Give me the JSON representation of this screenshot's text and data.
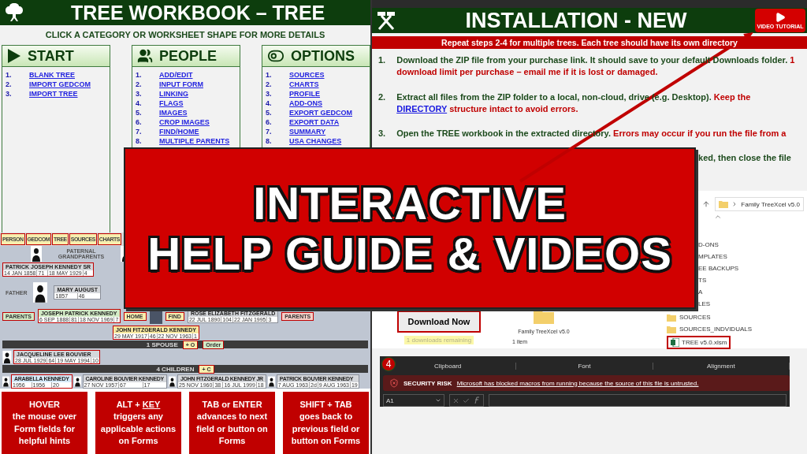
{
  "tree_workbook": {
    "title": "TREE WORKBOOK – TREE",
    "subtitle": "CLICK A CATEGORY OR WORKSHEET SHAPE FOR MORE DETAILS",
    "categories": [
      {
        "kind": "start",
        "title": "START",
        "items": [
          {
            "number": "1.",
            "label": "BLANK TREE"
          },
          {
            "number": "2.",
            "label": "IMPORT GEDCOM"
          },
          {
            "number": "3.",
            "label": "IMPORT TREE"
          }
        ]
      },
      {
        "kind": "people",
        "title": "PEOPLE",
        "items": [
          {
            "number": "1.",
            "label": "ADD/EDIT"
          },
          {
            "number": "2.",
            "label": "INPUT FORM"
          },
          {
            "number": "3.",
            "label": "LINKING"
          },
          {
            "number": "4.",
            "label": "FLAGS"
          },
          {
            "number": "5.",
            "label": "IMAGES"
          },
          {
            "number": "6.",
            "label": "CROP IMAGES"
          },
          {
            "number": "7.",
            "label": "FIND/HOME"
          },
          {
            "number": "8.",
            "label": "MULTIPLE PARENTS"
          }
        ]
      },
      {
        "kind": "options",
        "title": "OPTIONS",
        "items": [
          {
            "number": "1.",
            "label": "SOURCES"
          },
          {
            "number": "2.",
            "label": "CHARTS"
          },
          {
            "number": "3.",
            "label": "PROFILE"
          },
          {
            "number": "4.",
            "label": "ADD-ONS"
          },
          {
            "number": "5.",
            "label": "EXPORT GEDCOM"
          },
          {
            "number": "6.",
            "label": "EXPORT DATA"
          },
          {
            "number": "7.",
            "label": "SUMMARY"
          },
          {
            "number": "8.",
            "label": "USA CHANGES"
          }
        ]
      }
    ],
    "toolbar": [
      "PERSON",
      "GEDCOM",
      "TREE",
      "SOURCES",
      "CHARTS"
    ],
    "family_tree": {
      "grandparents_label": "PATERNAL GRANDPARENTS",
      "father_label": "FATHER",
      "parents_buttons": [
        "PARENTS",
        "PARENTS"
      ],
      "home_button": "HOME",
      "find_button": "FIND",
      "spouse_bar": "1 SPOUSE",
      "spouse_add": "+ O",
      "order_button": "Order",
      "children_bar": "4 CHILDREN",
      "child_add": "+ C",
      "grandparents": [
        {
          "name": "PATRICK JOSEPH KENNEDY SR",
          "kind": "plain",
          "highlighted": true,
          "dates": [
            "14 JAN 1858",
            "71",
            "18 MAY 1929",
            "4"
          ]
        },
        {
          "name": "MARY AUGUST",
          "kind": "plain",
          "highlighted": false,
          "dates": [
            "1857",
            "46"
          ]
        }
      ],
      "father": {
        "name": "JOSEPH PATRICK KENNEDY",
        "kind": "parent",
        "highlighted": true,
        "dates": [
          "6 SEP 1888",
          "81",
          "18 NOV 1969",
          "7"
        ]
      },
      "mother": {
        "name": "ROSE ELIZABETH FITZGERALD",
        "kind": "plain",
        "highlighted": false,
        "dates": [
          "22 JUL 1890",
          "104",
          "22 JAN 1995",
          "3"
        ]
      },
      "person": {
        "name": "JOHN FITZGERALD KENNEDY",
        "kind": "main",
        "highlighted": true,
        "dates": [
          "29 MAY 1917",
          "46",
          "22 NOV 1963",
          "1"
        ]
      },
      "spouse": {
        "name": "JACQUELINE LEE BOUVIER",
        "kind": "plain",
        "highlighted": true,
        "dates": [
          "28 JUL 1929",
          "64",
          "19 MAY 1994",
          "10"
        ]
      },
      "children": [
        {
          "name": "ARABELLA KENNEDY",
          "kind": "child",
          "highlighted": true,
          "dates": [
            "1956",
            "1956",
            "20"
          ]
        },
        {
          "name": "CAROLINE BOUVIER KENNEDY",
          "kind": "plain",
          "highlighted": false,
          "dates": [
            "27 NOV 1957",
            "67",
            "17"
          ]
        },
        {
          "name": "JOHN FITZGERALD KENNEDY JR",
          "kind": "plain",
          "highlighted": false,
          "dates": [
            "25 NOV 1960",
            "38",
            "16 JUL 1999",
            "18"
          ]
        },
        {
          "name": "PATRICK BOUVIER KENNEDY",
          "kind": "plain",
          "highlighted": false,
          "dates": [
            "7 AUG 1963",
            "2d",
            "9 AUG 1963",
            "19"
          ]
        }
      ]
    },
    "hints": [
      {
        "title": "HOVER",
        "text": "the mouse over Form fields for helpful hints"
      },
      {
        "title": "ALT +",
        "key": "KEY",
        "text": "triggers any applicable actions on Forms"
      },
      {
        "title": "TAB or ENTER",
        "text": "advances to next field or button on Forms"
      },
      {
        "title": "SHIFT + TAB",
        "text": "goes back to previous field or button on Forms"
      }
    ]
  },
  "installation": {
    "title": "INSTALLATION - NEW",
    "video_button": "VIDEO TUTORIAL",
    "notice": "Repeat steps 2-4 for multiple trees. Each tree should have its own directory",
    "steps": [
      {
        "number": "1.",
        "text": "Download the ZIP file from your purchase link. It should save to your default Downloads folder.",
        "warning": "1 download limit per purchase – email me if it is lost or damaged."
      },
      {
        "number": "2.",
        "text": "Extract all files from the ZIP folder to a local, non-cloud, drive (e.g. Desktop).",
        "warning": "Keep the",
        "link": "DIRECTORY",
        "warning_end": "structure intact to avoid errors."
      },
      {
        "number": "3.",
        "text": "Open the TREE workbook in the extracted directory.",
        "warning": "Errors may occur if you run the file from a"
      }
    ],
    "step_fragment": "ked, then close the file",
    "download": {
      "button": "Download Now",
      "remaining": "1 downloads remaining"
    },
    "folder": {
      "label": "Family TreeXcel v5.0",
      "item_count": "1 item"
    },
    "explorer": {
      "path": "Family TreeXcel v5.0",
      "partial_folders": [
        "D-ONS",
        "MPLATES",
        "EE BACKUPS",
        "TS",
        "A",
        "LES"
      ],
      "folders": [
        "SOURCES",
        "SOURCES_INDVIDUALS"
      ],
      "file": "TREE v5.0.xlsm"
    },
    "excel": {
      "badge": "4",
      "groups": [
        "Clipboard",
        "Font",
        "Alignment"
      ],
      "security_label": "SECURITY RISK",
      "security_message": "Microsoft has blocked macros from running because the source of this file is untrusted.",
      "name_box": "A1"
    }
  },
  "banner": {
    "lines": [
      "INTERACTIVE",
      "HELP GUIDE & VIDEOS"
    ]
  }
}
